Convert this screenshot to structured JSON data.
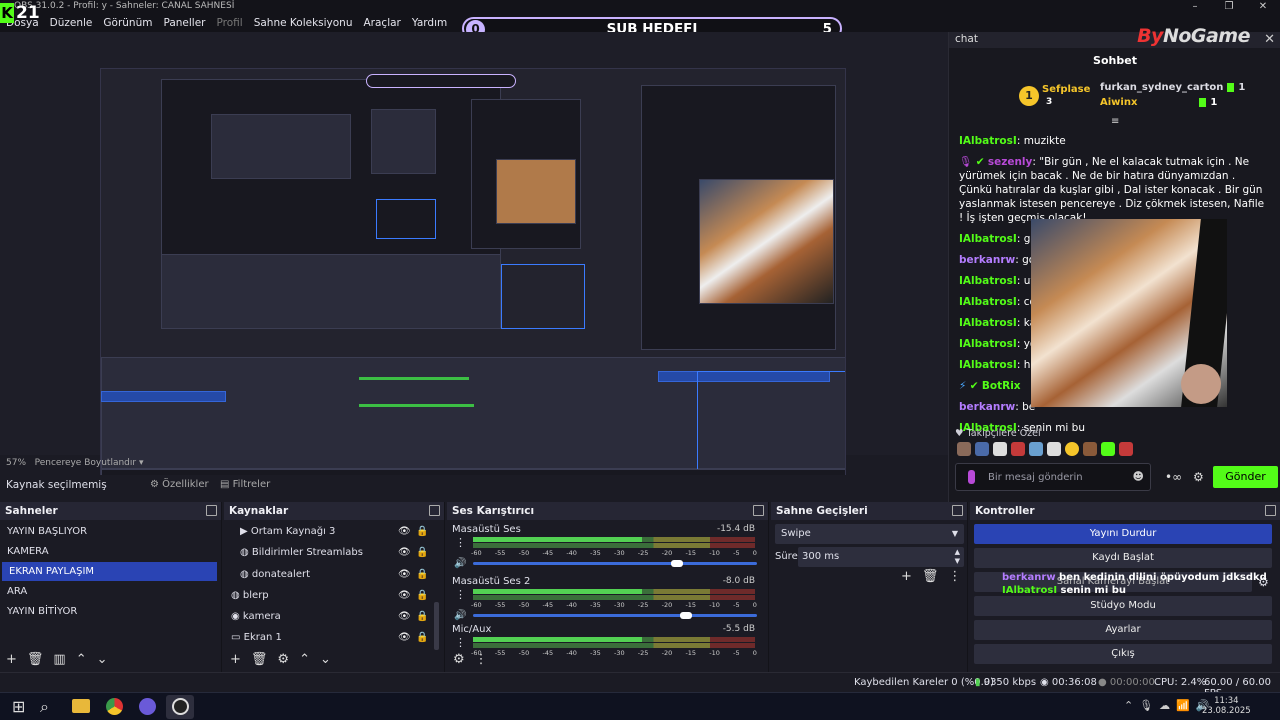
{
  "window": {
    "title": "OBS 31.0.2 - Profil: y - Sahneler: CANAL SAHNESİ",
    "overlay_logo": "21"
  },
  "menu": [
    "Dosya",
    "Düzenle",
    "Görünüm",
    "Paneller",
    "Profil",
    "Sahne Koleksiyonu",
    "Araçlar",
    "Yardım"
  ],
  "subgoal": {
    "current": "0",
    "label": "SUB HEDEFI",
    "target": "5"
  },
  "chat": {
    "dock_title": "chat",
    "brand_by": "By",
    "brand_rest": "NoGame",
    "header": "Sohbet",
    "leaders": [
      {
        "rank": "1",
        "name": "Sefplase",
        "count": "3",
        "color": "#f5c52a"
      },
      {
        "rank": "",
        "name": "furkan_sydney_carton",
        "count": "1",
        "color": "#dcdce4"
      },
      {
        "rank": "",
        "name": "Aiwinx",
        "count": "1",
        "color": "#f5c52a"
      }
    ],
    "messages": [
      {
        "user": "IAlbatrosI",
        "text": "muzikte",
        "color": "#53fc18"
      },
      {
        "user": "sezenly",
        "text": "\"Bir gün , Ne el kalacak tutmak için . Ne yürümek için bacak . Ne de bir hatıra dünyamızdan . Çünkü hatıralar da kuşlar gibi , Dal ister konacak . Bir gün yaslanmak istesen pencereye . Diz çökmek istesen, Nafile ! İş işten geçmiş olacak!",
        "color": "#b84ad8"
      },
      {
        "user": "IAlbatrosI",
        "text": "go",
        "color": "#53fc18"
      },
      {
        "user": "berkanrw",
        "text": "go",
        "color": "#b47dff"
      },
      {
        "user": "IAlbatrosI",
        "text": "uy",
        "color": "#53fc18"
      },
      {
        "user": "IAlbatrosI",
        "text": "co",
        "color": "#53fc18"
      },
      {
        "user": "IAlbatrosI",
        "text": "ka",
        "color": "#53fc18"
      },
      {
        "user": "IAlbatrosI",
        "text": "yo",
        "color": "#53fc18"
      },
      {
        "user": "IAlbatrosI",
        "text": "ha",
        "color": "#53fc18"
      },
      {
        "user": "BotRix",
        "text": "",
        "color": "#53fc18"
      },
      {
        "user": "berkanrw",
        "text": "be",
        "color": "#b47dff"
      },
      {
        "user": "IAlbatrosI",
        "text": "senin mi bu",
        "color": "#53fc18"
      }
    ],
    "subscribers_label": "Takipçilere Özel",
    "input_placeholder": "Bir mesaj gönderin",
    "send_label": "Gönder"
  },
  "preview": {
    "zoom": "57%",
    "fit": "Pencereye Boyutlandır"
  },
  "source_bar": {
    "status": "Kaynak seçilmemiş",
    "properties": "Özellikler",
    "filters": "Filtreler"
  },
  "scenes": {
    "title": "Sahneler",
    "items": [
      "YAYIN BAŞLIYOR",
      "KAMERA",
      "EKRAN PAYLAŞIM",
      "ARA",
      "YAYIN BİTİYOR"
    ],
    "selected": 2
  },
  "sources": {
    "title": "Kaynaklar",
    "items": [
      {
        "name": "Ortam Kaynağı 3",
        "icon": "play-icon",
        "indent": true
      },
      {
        "name": "Bildirimler Streamlabs",
        "icon": "globe-icon",
        "indent": true
      },
      {
        "name": "donatealert",
        "icon": "globe-icon",
        "indent": true
      },
      {
        "name": "blerp",
        "icon": "globe-icon",
        "indent": false
      },
      {
        "name": "kamera",
        "icon": "camera-icon",
        "indent": false
      },
      {
        "name": "Ekran 1",
        "icon": "monitor-icon",
        "indent": false
      }
    ]
  },
  "mixer": {
    "title": "Ses Karıştırıcı",
    "ticks": [
      "-60",
      "-55",
      "-50",
      "-45",
      "-40",
      "-35",
      "-30",
      "-25",
      "-20",
      "-15",
      "-10",
      "-5",
      "0"
    ],
    "channels": [
      {
        "name": "Masaüstü Ses",
        "db": "-15.4 dB",
        "level": 0.72
      },
      {
        "name": "Masaüstü Ses 2",
        "db": "-8.0 dB",
        "level": 0.75
      },
      {
        "name": "Mic/Aux",
        "db": "-5.5 dB",
        "level": 0.5
      }
    ]
  },
  "transitions": {
    "title": "Sahne Geçişleri",
    "type": "Swipe",
    "duration_label": "Süre",
    "duration": "300 ms"
  },
  "controls": {
    "title": "Kontroller",
    "buttons": [
      "Yayını Durdur",
      "Kaydı Başlat",
      "Sanal Kamerayı Başlat",
      "Stüdyo Modu",
      "Ayarlar",
      "Çıkış"
    ],
    "overlay": [
      {
        "user": "berkanrw",
        "text": "ben kedinin dilini öpüyodum jdksdkd",
        "color": "#b47dff"
      },
      {
        "user": "IAlbatrosI",
        "text": "senin mi bu",
        "color": "#53fc18"
      }
    ]
  },
  "statusbar": {
    "dropped": "Kaybedilen Kareler 0 (%0.0)",
    "bitrate": "9350 kbps",
    "stream_time": "00:36:08",
    "rec_time": "00:00:00",
    "cpu": "CPU: 2.4%",
    "fps": "60.00 / 60.00 FPS"
  },
  "taskbar": {
    "time": "11:34",
    "date": "23.08.2025"
  }
}
